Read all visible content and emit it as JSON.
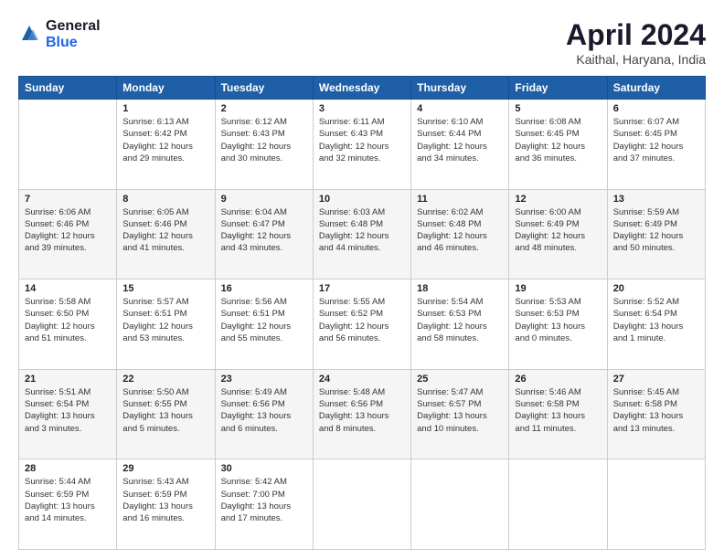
{
  "header": {
    "logo_general": "General",
    "logo_blue": "Blue",
    "title": "April 2024",
    "location": "Kaithal, Haryana, India"
  },
  "days_of_week": [
    "Sunday",
    "Monday",
    "Tuesday",
    "Wednesday",
    "Thursday",
    "Friday",
    "Saturday"
  ],
  "weeks": [
    [
      {
        "num": "",
        "info": ""
      },
      {
        "num": "1",
        "info": "Sunrise: 6:13 AM\nSunset: 6:42 PM\nDaylight: 12 hours\nand 29 minutes."
      },
      {
        "num": "2",
        "info": "Sunrise: 6:12 AM\nSunset: 6:43 PM\nDaylight: 12 hours\nand 30 minutes."
      },
      {
        "num": "3",
        "info": "Sunrise: 6:11 AM\nSunset: 6:43 PM\nDaylight: 12 hours\nand 32 minutes."
      },
      {
        "num": "4",
        "info": "Sunrise: 6:10 AM\nSunset: 6:44 PM\nDaylight: 12 hours\nand 34 minutes."
      },
      {
        "num": "5",
        "info": "Sunrise: 6:08 AM\nSunset: 6:45 PM\nDaylight: 12 hours\nand 36 minutes."
      },
      {
        "num": "6",
        "info": "Sunrise: 6:07 AM\nSunset: 6:45 PM\nDaylight: 12 hours\nand 37 minutes."
      }
    ],
    [
      {
        "num": "7",
        "info": "Sunrise: 6:06 AM\nSunset: 6:46 PM\nDaylight: 12 hours\nand 39 minutes."
      },
      {
        "num": "8",
        "info": "Sunrise: 6:05 AM\nSunset: 6:46 PM\nDaylight: 12 hours\nand 41 minutes."
      },
      {
        "num": "9",
        "info": "Sunrise: 6:04 AM\nSunset: 6:47 PM\nDaylight: 12 hours\nand 43 minutes."
      },
      {
        "num": "10",
        "info": "Sunrise: 6:03 AM\nSunset: 6:48 PM\nDaylight: 12 hours\nand 44 minutes."
      },
      {
        "num": "11",
        "info": "Sunrise: 6:02 AM\nSunset: 6:48 PM\nDaylight: 12 hours\nand 46 minutes."
      },
      {
        "num": "12",
        "info": "Sunrise: 6:00 AM\nSunset: 6:49 PM\nDaylight: 12 hours\nand 48 minutes."
      },
      {
        "num": "13",
        "info": "Sunrise: 5:59 AM\nSunset: 6:49 PM\nDaylight: 12 hours\nand 50 minutes."
      }
    ],
    [
      {
        "num": "14",
        "info": "Sunrise: 5:58 AM\nSunset: 6:50 PM\nDaylight: 12 hours\nand 51 minutes."
      },
      {
        "num": "15",
        "info": "Sunrise: 5:57 AM\nSunset: 6:51 PM\nDaylight: 12 hours\nand 53 minutes."
      },
      {
        "num": "16",
        "info": "Sunrise: 5:56 AM\nSunset: 6:51 PM\nDaylight: 12 hours\nand 55 minutes."
      },
      {
        "num": "17",
        "info": "Sunrise: 5:55 AM\nSunset: 6:52 PM\nDaylight: 12 hours\nand 56 minutes."
      },
      {
        "num": "18",
        "info": "Sunrise: 5:54 AM\nSunset: 6:53 PM\nDaylight: 12 hours\nand 58 minutes."
      },
      {
        "num": "19",
        "info": "Sunrise: 5:53 AM\nSunset: 6:53 PM\nDaylight: 13 hours\nand 0 minutes."
      },
      {
        "num": "20",
        "info": "Sunrise: 5:52 AM\nSunset: 6:54 PM\nDaylight: 13 hours\nand 1 minute."
      }
    ],
    [
      {
        "num": "21",
        "info": "Sunrise: 5:51 AM\nSunset: 6:54 PM\nDaylight: 13 hours\nand 3 minutes."
      },
      {
        "num": "22",
        "info": "Sunrise: 5:50 AM\nSunset: 6:55 PM\nDaylight: 13 hours\nand 5 minutes."
      },
      {
        "num": "23",
        "info": "Sunrise: 5:49 AM\nSunset: 6:56 PM\nDaylight: 13 hours\nand 6 minutes."
      },
      {
        "num": "24",
        "info": "Sunrise: 5:48 AM\nSunset: 6:56 PM\nDaylight: 13 hours\nand 8 minutes."
      },
      {
        "num": "25",
        "info": "Sunrise: 5:47 AM\nSunset: 6:57 PM\nDaylight: 13 hours\nand 10 minutes."
      },
      {
        "num": "26",
        "info": "Sunrise: 5:46 AM\nSunset: 6:58 PM\nDaylight: 13 hours\nand 11 minutes."
      },
      {
        "num": "27",
        "info": "Sunrise: 5:45 AM\nSunset: 6:58 PM\nDaylight: 13 hours\nand 13 minutes."
      }
    ],
    [
      {
        "num": "28",
        "info": "Sunrise: 5:44 AM\nSunset: 6:59 PM\nDaylight: 13 hours\nand 14 minutes."
      },
      {
        "num": "29",
        "info": "Sunrise: 5:43 AM\nSunset: 6:59 PM\nDaylight: 13 hours\nand 16 minutes."
      },
      {
        "num": "30",
        "info": "Sunrise: 5:42 AM\nSunset: 7:00 PM\nDaylight: 13 hours\nand 17 minutes."
      },
      {
        "num": "",
        "info": ""
      },
      {
        "num": "",
        "info": ""
      },
      {
        "num": "",
        "info": ""
      },
      {
        "num": "",
        "info": ""
      }
    ]
  ]
}
